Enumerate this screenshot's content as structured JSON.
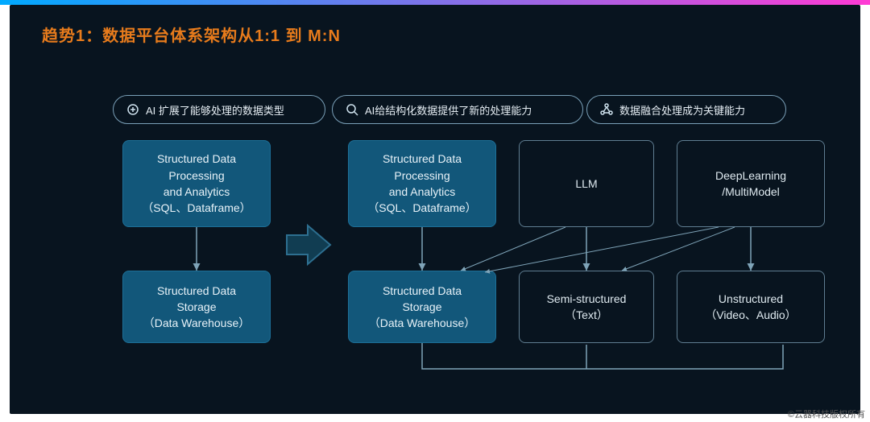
{
  "title": "趋势1：数据平台体系架构从1:1 到 M:N",
  "pills": {
    "p1": "AI 扩展了能够处理的数据类型",
    "p2": "AI给结构化数据提供了新的处理能力",
    "p3": "数据融合处理成为关键能力"
  },
  "boxes": {
    "proc_left": "Structured Data\nProcessing\nand Analytics\n（SQL、Dataframe）",
    "store_left": "Structured Data\nStorage\n（Data Warehouse）",
    "proc_right": "Structured Data\nProcessing\nand Analytics\n（SQL、Dataframe）",
    "store_right": "Structured Data\nStorage\n（Data Warehouse）",
    "llm": "LLM",
    "deep": "DeepLearning\n/MultiModel",
    "semi": "Semi-structured\n（Text）",
    "unstr": "Unstructured\n（Video、Audio）"
  },
  "footer": "©云器科技版权所有",
  "colors": {
    "accent": "#e77b1c",
    "node": "#12577a",
    "bg": "#08141f"
  }
}
